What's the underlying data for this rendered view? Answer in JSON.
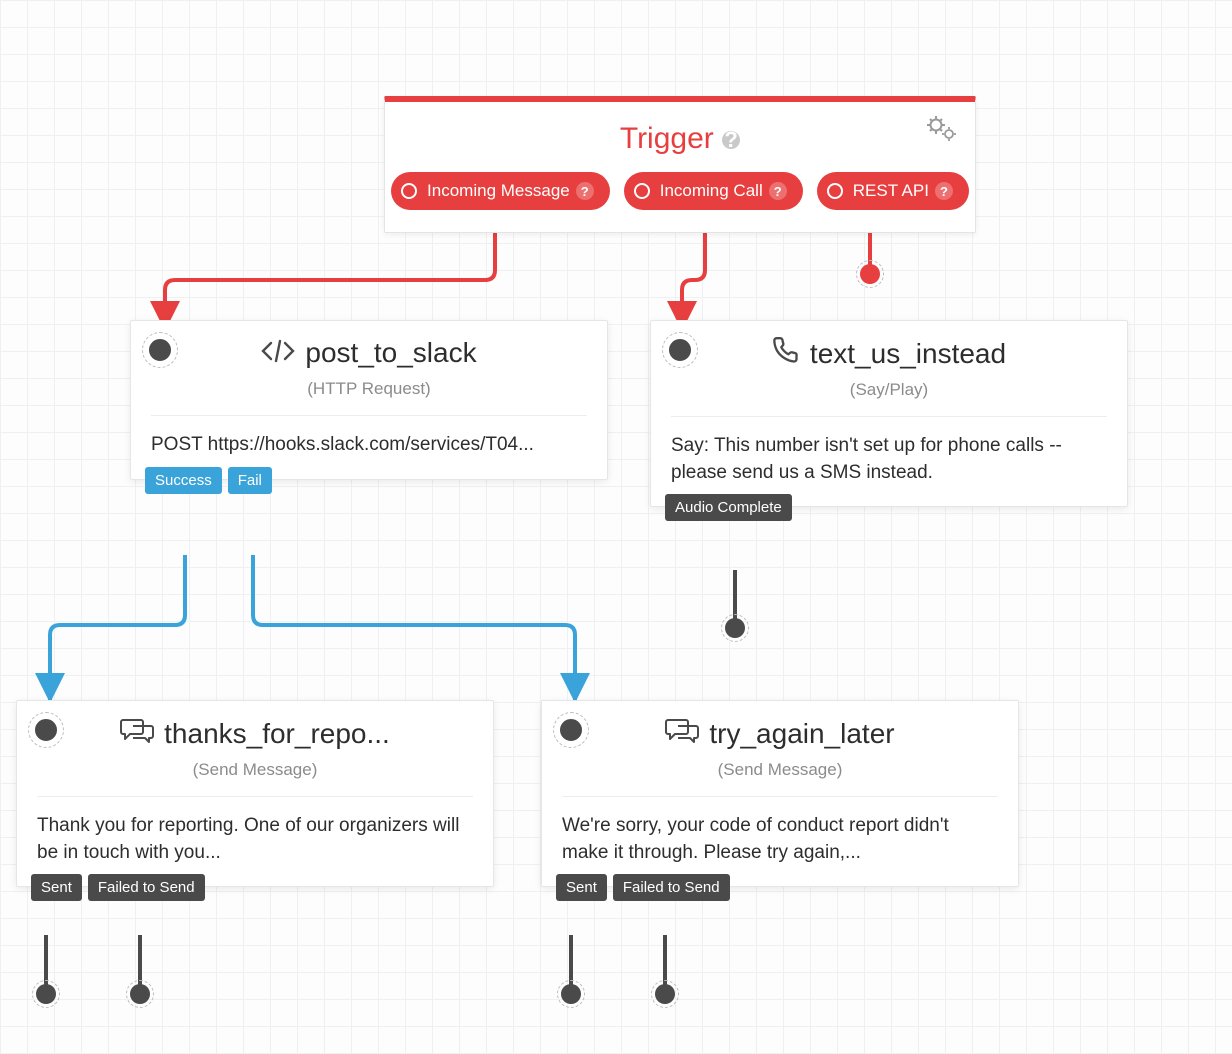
{
  "colors": {
    "accent_red": "#e73f3f",
    "accent_blue": "#3aa3d9",
    "tag_dark": "#4a4a4a"
  },
  "trigger": {
    "title": "Trigger",
    "options": [
      {
        "label": "Incoming Message"
      },
      {
        "label": "Incoming Call"
      },
      {
        "label": "REST API"
      }
    ]
  },
  "widgets": {
    "post_to_slack": {
      "name": "post_to_slack",
      "type": "(HTTP Request)",
      "body": "POST https://hooks.slack.com/services/T04...",
      "outputs": [
        {
          "label": "Success",
          "style": "blue"
        },
        {
          "label": "Fail",
          "style": "blue"
        }
      ]
    },
    "text_us_instead": {
      "name": "text_us_instead",
      "type": "(Say/Play)",
      "body": "Say: This number isn't set up for phone calls -- please send us a SMS instead.",
      "outputs": [
        {
          "label": "Audio Complete",
          "style": "dark"
        }
      ]
    },
    "thanks_for_repo": {
      "name": "thanks_for_repo...",
      "type": "(Send Message)",
      "body": "Thank you for reporting. One of our organizers will be in touch with you...",
      "outputs": [
        {
          "label": "Sent",
          "style": "dark"
        },
        {
          "label": "Failed to Send",
          "style": "dark"
        }
      ]
    },
    "try_again_later": {
      "name": "try_again_later",
      "type": "(Send Message)",
      "body": "We're sorry, your code of conduct report didn't make it through. Please try again,...",
      "outputs": [
        {
          "label": "Sent",
          "style": "dark"
        },
        {
          "label": "Failed to Send",
          "style": "dark"
        }
      ]
    }
  }
}
